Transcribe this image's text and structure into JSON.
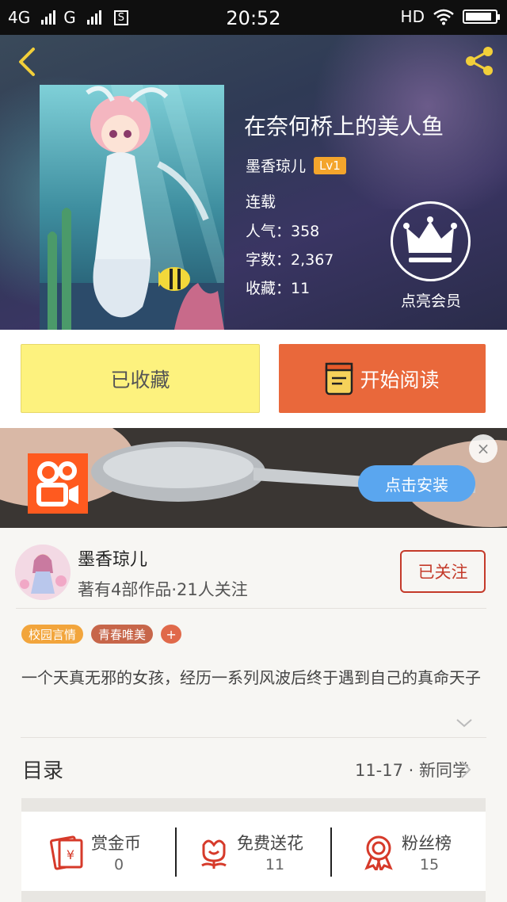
{
  "status_bar": {
    "network1": "4G",
    "network2": "G",
    "sim_icon": "S",
    "time": "20:52",
    "hd": "HD"
  },
  "book": {
    "title": "在奈何桥上的美人鱼",
    "author": "墨香琼儿",
    "level": "Lv1",
    "status": "连载",
    "popularity": "人气：358",
    "word_count": "字数：2,367",
    "favorites": "收藏：11",
    "vip_label": "点亮会员"
  },
  "actions": {
    "favorited_label": "已收藏",
    "read_label": "开始阅读"
  },
  "ad": {
    "install_label": "点击安装",
    "close_icon": "×"
  },
  "author_card": {
    "name": "墨香琼儿",
    "stats": "著有4部作品·21人关注",
    "follow_label": "已关注"
  },
  "tags": [
    {
      "label": "校园言情",
      "color": "#f2a53c"
    },
    {
      "label": "青春唯美",
      "color": "#c7664a"
    },
    {
      "label": "+",
      "color": "#e0694a"
    }
  ],
  "description": "一个天真无邪的女孩，经历一系列风波后终于遇到自己的真命天子",
  "toc": {
    "title": "目录",
    "latest": "11-17 · 新同学"
  },
  "rewards": [
    {
      "label": "赏金币",
      "value": "0",
      "icon": "coin-envelope-icon"
    },
    {
      "label": "免费送花",
      "value": "11",
      "icon": "flower-icon"
    },
    {
      "label": "粉丝榜",
      "value": "15",
      "icon": "medal-icon"
    }
  ],
  "colors": {
    "accent_orange": "#e9683b",
    "fav_yellow": "#fdf27e",
    "follow_red": "#c43a2a",
    "icon_red": "#d63a2a"
  }
}
